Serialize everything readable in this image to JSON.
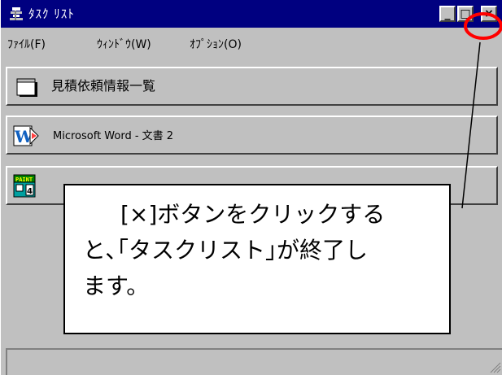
{
  "window": {
    "title": "ﾀｽｸ ﾘｽﾄ",
    "icon": "task-list-app-icon",
    "buttons": {
      "minimize": "_",
      "maximize": "□",
      "close": "×"
    }
  },
  "menu": {
    "items": [
      {
        "label": "ﾌｧｲﾙ(F)"
      },
      {
        "label": "ｳｨﾝﾄﾞｳ(W)"
      },
      {
        "label": "ｵﾌﾟｼｮﾝ(O)"
      }
    ]
  },
  "tasks": [
    {
      "label": "見積依頼情報一覧",
      "icon": "folder-icon"
    },
    {
      "label": "Microsoft Word - 文書 2",
      "icon": "word-icon"
    },
    {
      "label": "",
      "icon": "paint-icon"
    }
  ],
  "callout": {
    "line1": "[×]ボタンをクリックする",
    "line2": "と､｢タスクリスト｣が終了し",
    "line3": "ます。"
  },
  "colors": {
    "titlebar": "#000080",
    "face": "#c0c0c0",
    "annotation": "#ff0000"
  }
}
